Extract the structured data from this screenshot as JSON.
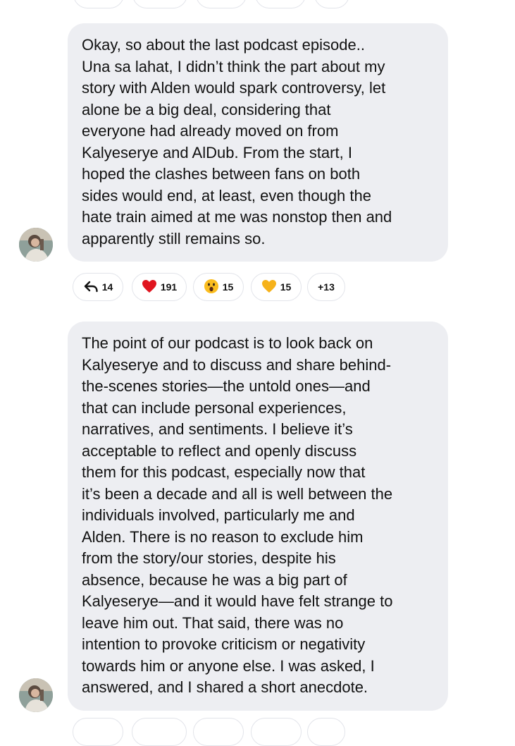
{
  "messages": [
    {
      "lines": [
        "Okay, so about the last podcast episode..",
        "Una sa lahat, I didn’t think the part about my",
        "story with Alden would spark controversy, let",
        "alone be a big deal, considering that",
        "everyone had already moved on from",
        "Kalyeserye and AlDub. From the start, I",
        "hoped the clashes between fans on both",
        "sides would end, at least, even though the",
        "hate train aimed at me was nonstop then and",
        "apparently still remains so."
      ],
      "reactions": {
        "replies": "14",
        "heart": "191",
        "wow": "15",
        "yellow_heart": "15",
        "more": "+13"
      }
    },
    {
      "lines": [
        "The point of our podcast is to look back on",
        "Kalyeserye and to discuss and share behind-",
        "the-scenes stories—the untold ones—and",
        "that can include personal experiences,",
        "narratives, and sentiments. I believe it’s",
        "acceptable to reflect and openly discuss",
        "them for this podcast, especially now that",
        "it’s been a decade and all is well between the",
        "individuals involved, particularly me and",
        "Alden. There is no reason to exclude him",
        "from the story/our stories, despite his",
        "absence, because he was a big part of",
        "Kalyeserye—and it would have felt strange to",
        "leave him out. That said, there was no",
        "intention to provoke criticism or negativity",
        "towards him or anyone else. I was asked, I",
        "answered, and I shared a short anecdote."
      ]
    }
  ],
  "icons": {
    "reply": "reply-arrow-icon",
    "heart": "red-heart-emoji",
    "wow": "surprised-face-emoji",
    "yellow_heart": "yellow-heart-emoji"
  },
  "colors": {
    "bubble": "#edeef2",
    "pill_border": "#e2e4ea",
    "text": "#111111"
  }
}
